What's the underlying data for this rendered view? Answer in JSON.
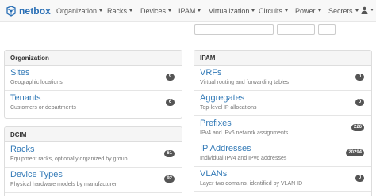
{
  "brand": {
    "name": "netbox"
  },
  "nav": [
    {
      "label": "Organization"
    },
    {
      "label": "Racks"
    },
    {
      "label": "Devices"
    },
    {
      "label": "IPAM"
    },
    {
      "label": "Virtualization"
    },
    {
      "label": "Circuits"
    },
    {
      "label": "Power"
    },
    {
      "label": "Secrets"
    }
  ],
  "left": {
    "organization": {
      "heading": "Organization",
      "items": [
        {
          "title": "Sites",
          "desc": "Geographic locations",
          "count": "9"
        },
        {
          "title": "Tenants",
          "desc": "Customers or departments",
          "count": "6"
        }
      ]
    },
    "dcim": {
      "heading": "DCIM",
      "items": [
        {
          "title": "Racks",
          "desc": "Equipment racks, optionally organized by group",
          "count": "61"
        },
        {
          "title": "Device Types",
          "desc": "Physical hardware models by manufacturer",
          "count": "92"
        }
      ]
    }
  },
  "right": {
    "ipam": {
      "heading": "IPAM",
      "items": [
        {
          "title": "VRFs",
          "desc": "Virtual routing and forwarding tables",
          "count": "0"
        },
        {
          "title": "Aggregates",
          "desc": "Top-level IP allocations",
          "count": "0"
        },
        {
          "title": "Prefixes",
          "desc": "IPv4 and IPv6 network assignments",
          "count": "226"
        },
        {
          "title": "IP Addresses",
          "desc": "Individual IPv4 and IPv6 addresses",
          "count": "20294"
        },
        {
          "title": "VLANs",
          "desc": "Layer two domains, identified by VLAN ID",
          "count": "0"
        }
      ]
    }
  }
}
